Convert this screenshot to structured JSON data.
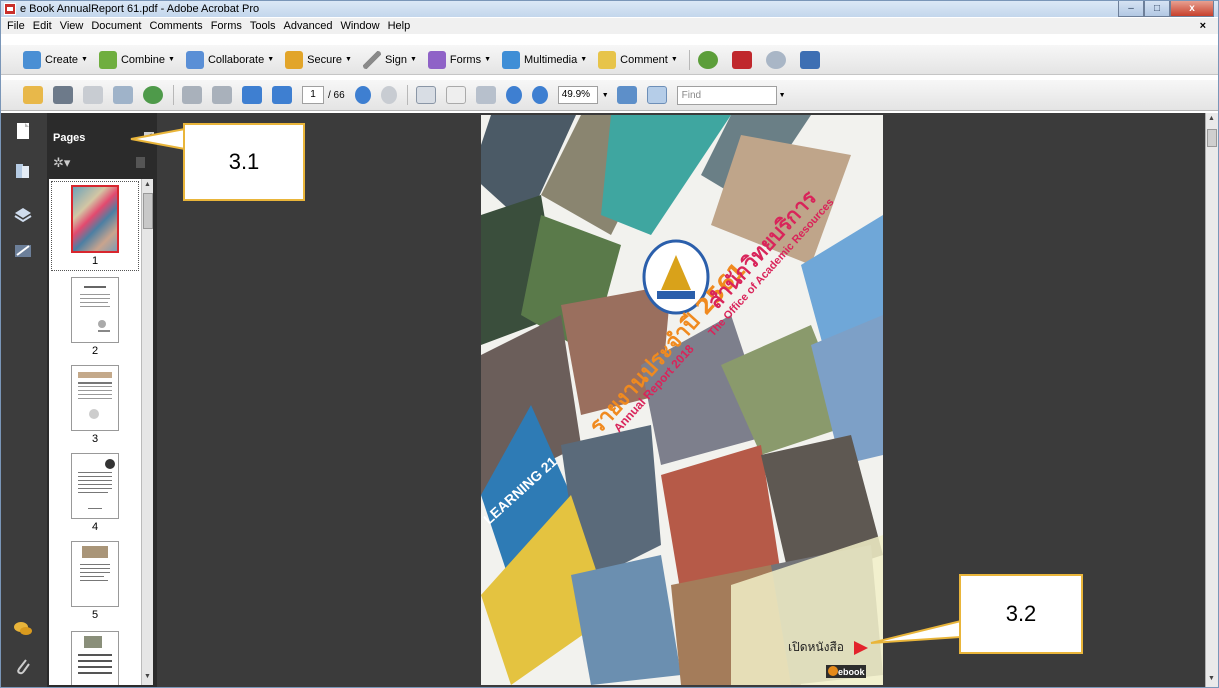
{
  "window": {
    "title": "e Book AnnualReport 61.pdf - Adobe Acrobat Pro",
    "minimize": "–",
    "maximize": "□",
    "close": "x"
  },
  "menu": {
    "items": [
      "File",
      "Edit",
      "View",
      "Document",
      "Comments",
      "Forms",
      "Tools",
      "Advanced",
      "Window",
      "Help"
    ],
    "close_doc": "×"
  },
  "toolbar1": {
    "items": [
      {
        "label": "Create",
        "icon": "create-icon",
        "color": "#4a8fd4"
      },
      {
        "label": "Combine",
        "icon": "combine-icon",
        "color": "#6fae3f"
      },
      {
        "label": "Collaborate",
        "icon": "collaborate-icon",
        "color": "#5a8fd6"
      },
      {
        "label": "Secure",
        "icon": "lock-icon",
        "color": "#e2a52a"
      },
      {
        "label": "Sign",
        "icon": "pen-icon",
        "color": "#8a8a8a"
      },
      {
        "label": "Forms",
        "icon": "forms-icon",
        "color": "#8f62c7"
      },
      {
        "label": "Multimedia",
        "icon": "multimedia-icon",
        "color": "#3f8ed6"
      },
      {
        "label": "Comment",
        "icon": "comment-icon",
        "color": "#e7c44a"
      }
    ]
  },
  "toolbar2": {
    "page_current": "1",
    "page_total": "/ 66",
    "zoom": "49.9%",
    "find_placeholder": "Find"
  },
  "pages_panel": {
    "title": "Pages",
    "thumbnails": [
      "1",
      "2",
      "3",
      "4",
      "5"
    ]
  },
  "document": {
    "cover_title_th": "สำนักวิทยบริการ",
    "cover_title_en": "The Office of Academic Resources",
    "cover_report_th": "รายงานประจำปี 2561",
    "cover_report_en": "Annual Report 2018",
    "open_book_label": "เปิดหนังสือ",
    "ebook_badge": "ebook",
    "learning_text": "LEARNING 21"
  },
  "callouts": {
    "c1": "3.1",
    "c2": "3.2"
  },
  "colors": {
    "callout_border": "#e9b53a",
    "doc_bg": "#3b3b3b",
    "panel_bg": "#2b2b2b",
    "cover_title": "#d9245a",
    "cover_report": "#f08a1f"
  }
}
